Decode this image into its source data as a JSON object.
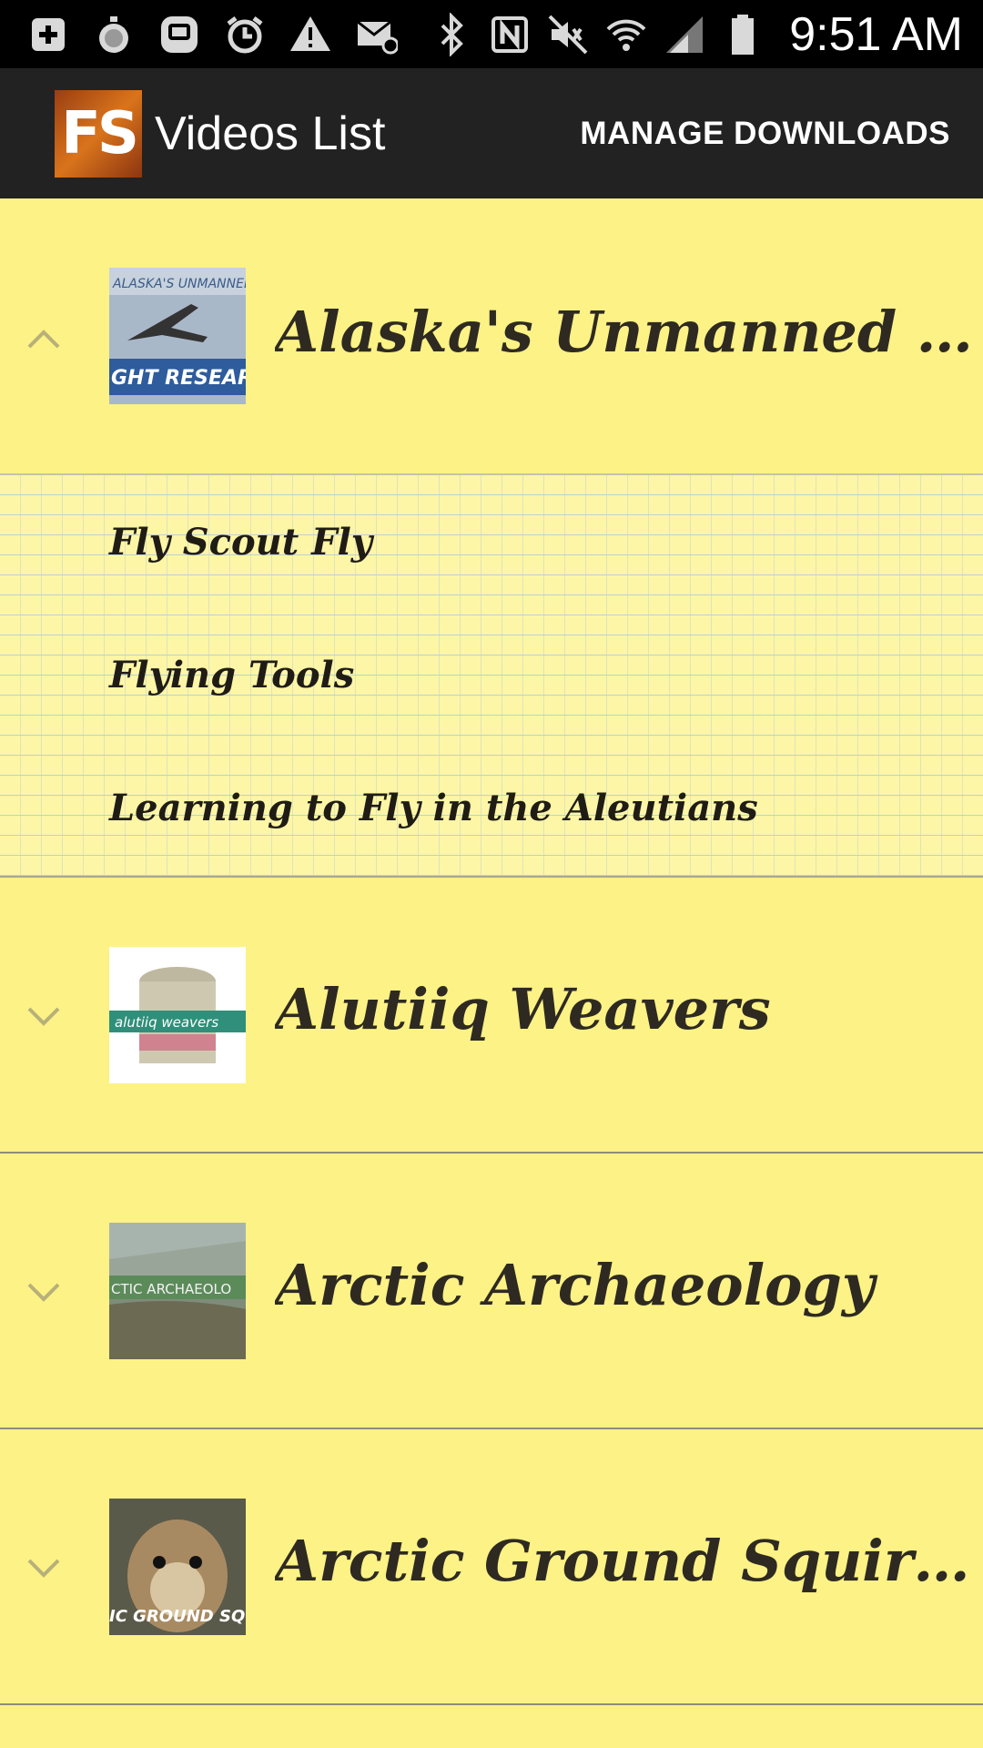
{
  "status_bar": {
    "time": "9:51 AM",
    "icons": [
      "add-box-icon",
      "stopwatch-icon",
      "bbm-icon",
      "alarm-icon",
      "warning-icon",
      "mail-icon",
      "bluetooth-icon",
      "nfc-icon",
      "mute-icon",
      "wifi-icon",
      "signal-icon",
      "battery-icon"
    ]
  },
  "action_bar": {
    "logo_text": "FS",
    "title": "Videos List",
    "manage_downloads": "MANAGE DOWNLOADS"
  },
  "groups": [
    {
      "title": "Alaska's Unmanned Aircr...",
      "expanded": true,
      "thumb_text": "GHT RESEAR",
      "children": [
        "Fly Scout Fly",
        "Flying Tools",
        "Learning to Fly in the Aleutians"
      ]
    },
    {
      "title": "Alutiiq Weavers",
      "expanded": false,
      "thumb_text": "alutiiq weavers"
    },
    {
      "title": "Arctic Archaeology",
      "expanded": false,
      "thumb_text": "CTIC ARCHAEOLO"
    },
    {
      "title": "Arctic Ground Squirrel",
      "expanded": false,
      "thumb_text": "IC GROUND SQU"
    }
  ],
  "colors": {
    "background": "#fdf285",
    "action_bar": "#222222",
    "status_bar": "#000000",
    "text": "#2e2a22"
  }
}
